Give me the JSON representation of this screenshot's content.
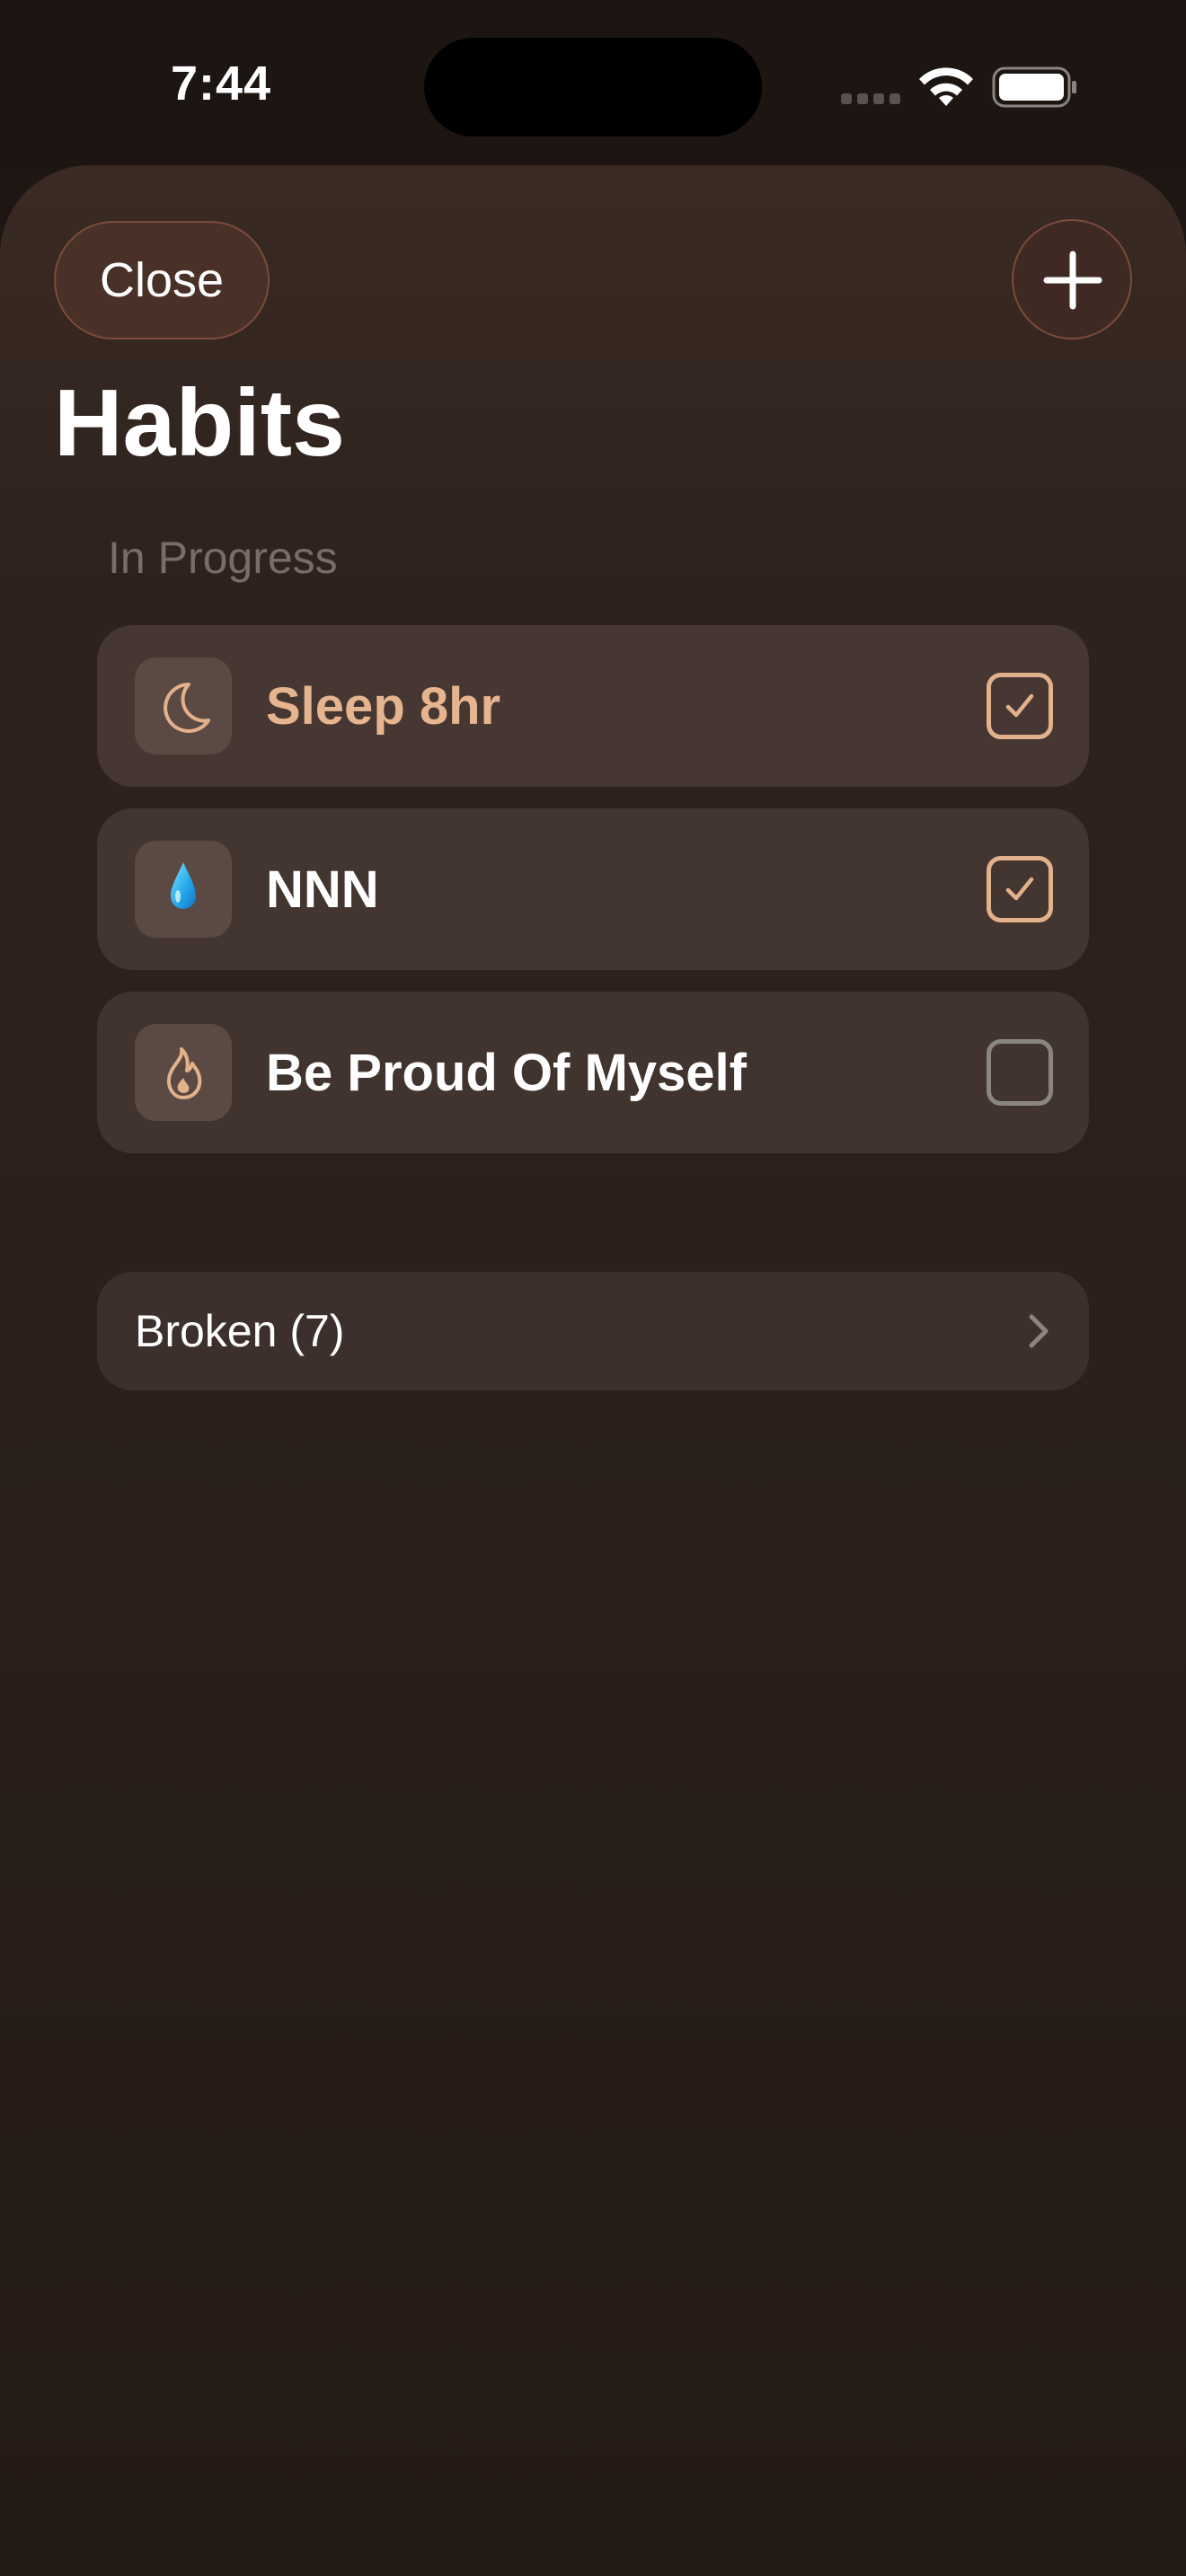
{
  "status_bar": {
    "time": "7:44"
  },
  "toolbar": {
    "close_label": "Close",
    "add_icon": "plus-icon"
  },
  "page": {
    "title": "Habits"
  },
  "sections": {
    "in_progress": {
      "header": "In Progress",
      "habits": [
        {
          "name": "Sleep 8hr",
          "icon": "moon-icon",
          "checked": true,
          "accent": true
        },
        {
          "name": "NNN",
          "icon": "water-drop-icon",
          "checked": true,
          "accent": false
        },
        {
          "name": "Be Proud Of Myself",
          "icon": "flame-icon",
          "checked": false,
          "accent": false
        }
      ]
    },
    "broken": {
      "label": "Broken (7)"
    }
  },
  "colors": {
    "accent": "#e6b48f",
    "background": "#2b201b",
    "row": "#443631"
  }
}
